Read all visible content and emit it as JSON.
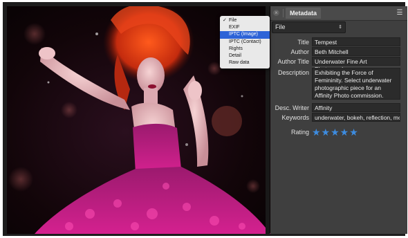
{
  "panel": {
    "tab_label": "Metadata",
    "close_glyph": "×",
    "menu_glyph": "☰",
    "source_select": {
      "value": "File",
      "arrow": "⇕"
    },
    "fields": {
      "title": {
        "label": "Title",
        "value": "Tempest"
      },
      "author": {
        "label": "Author",
        "value": "Beth Mitchell"
      },
      "author_title": {
        "label": "Author Title",
        "value": "Underwater Fine Art Photographer"
      },
      "description": {
        "label": "Description",
        "value": "Exhibiting the Force of Femininity. Select underwater photographic piece for an Affinity Photo commission."
      },
      "desc_writer": {
        "label": "Desc. Writer",
        "value": "Affinity"
      },
      "keywords": {
        "label": "Keywords",
        "value": "underwater, bokeh, reflection, model"
      },
      "rating": {
        "label": "Rating",
        "stars": "★★★★★",
        "value": 5,
        "max": 5
      }
    }
  },
  "menu": {
    "checkmark": "✓",
    "items": [
      {
        "label": "File",
        "checked": true,
        "selected": false
      },
      {
        "label": "EXIF",
        "checked": false,
        "selected": false
      },
      {
        "label": "IPTC (Image)",
        "checked": false,
        "selected": true
      },
      {
        "label": "IPTC (Contact)",
        "checked": false,
        "selected": false
      },
      {
        "label": "Rights",
        "checked": false,
        "selected": false
      },
      {
        "label": "Detail",
        "checked": false,
        "selected": false
      },
      {
        "label": "Raw data",
        "checked": false,
        "selected": false
      }
    ]
  },
  "colors": {
    "accent": "#2d63d7",
    "star": "#3d8ce0",
    "panel_bg": "#3f3f3f"
  },
  "photo": {
    "subject": "underwater-portrait-image"
  }
}
